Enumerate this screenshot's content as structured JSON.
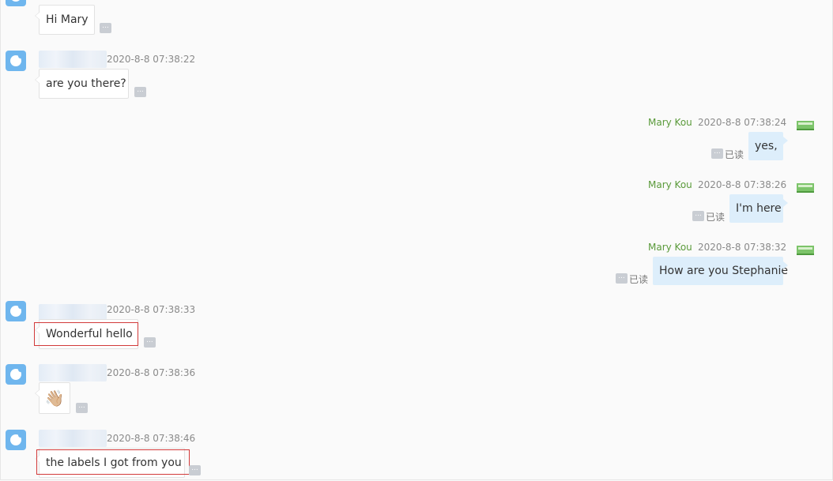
{
  "messages_left": [
    {
      "text": "Hi Mary"
    },
    {
      "timestamp": "2020-8-8 07:38:22",
      "text": "are you there?"
    },
    {
      "timestamp": "2020-8-8 07:38:33",
      "text": "Wonderful hello"
    },
    {
      "timestamp": "2020-8-8 07:38:36",
      "text": "👋🏼"
    },
    {
      "timestamp": "2020-8-8 07:38:46",
      "text": "the labels I got from you"
    }
  ],
  "messages_right": [
    {
      "sender": "Mary Kou",
      "timestamp": "2020-8-8 07:38:24",
      "text": "yes,",
      "status": "已读"
    },
    {
      "sender": "Mary Kou",
      "timestamp": "2020-8-8 07:38:26",
      "text": "I'm here",
      "status": "已读"
    },
    {
      "sender": "Mary Kou",
      "timestamp": "2020-8-8 07:38:32",
      "text": "How are you Stephanie",
      "status": "已读"
    }
  ],
  "more_label": "...",
  "colors": {
    "highlight": "#d23a3a",
    "sender": "#5a9a3a",
    "bubble_right": "#ddeefb"
  }
}
